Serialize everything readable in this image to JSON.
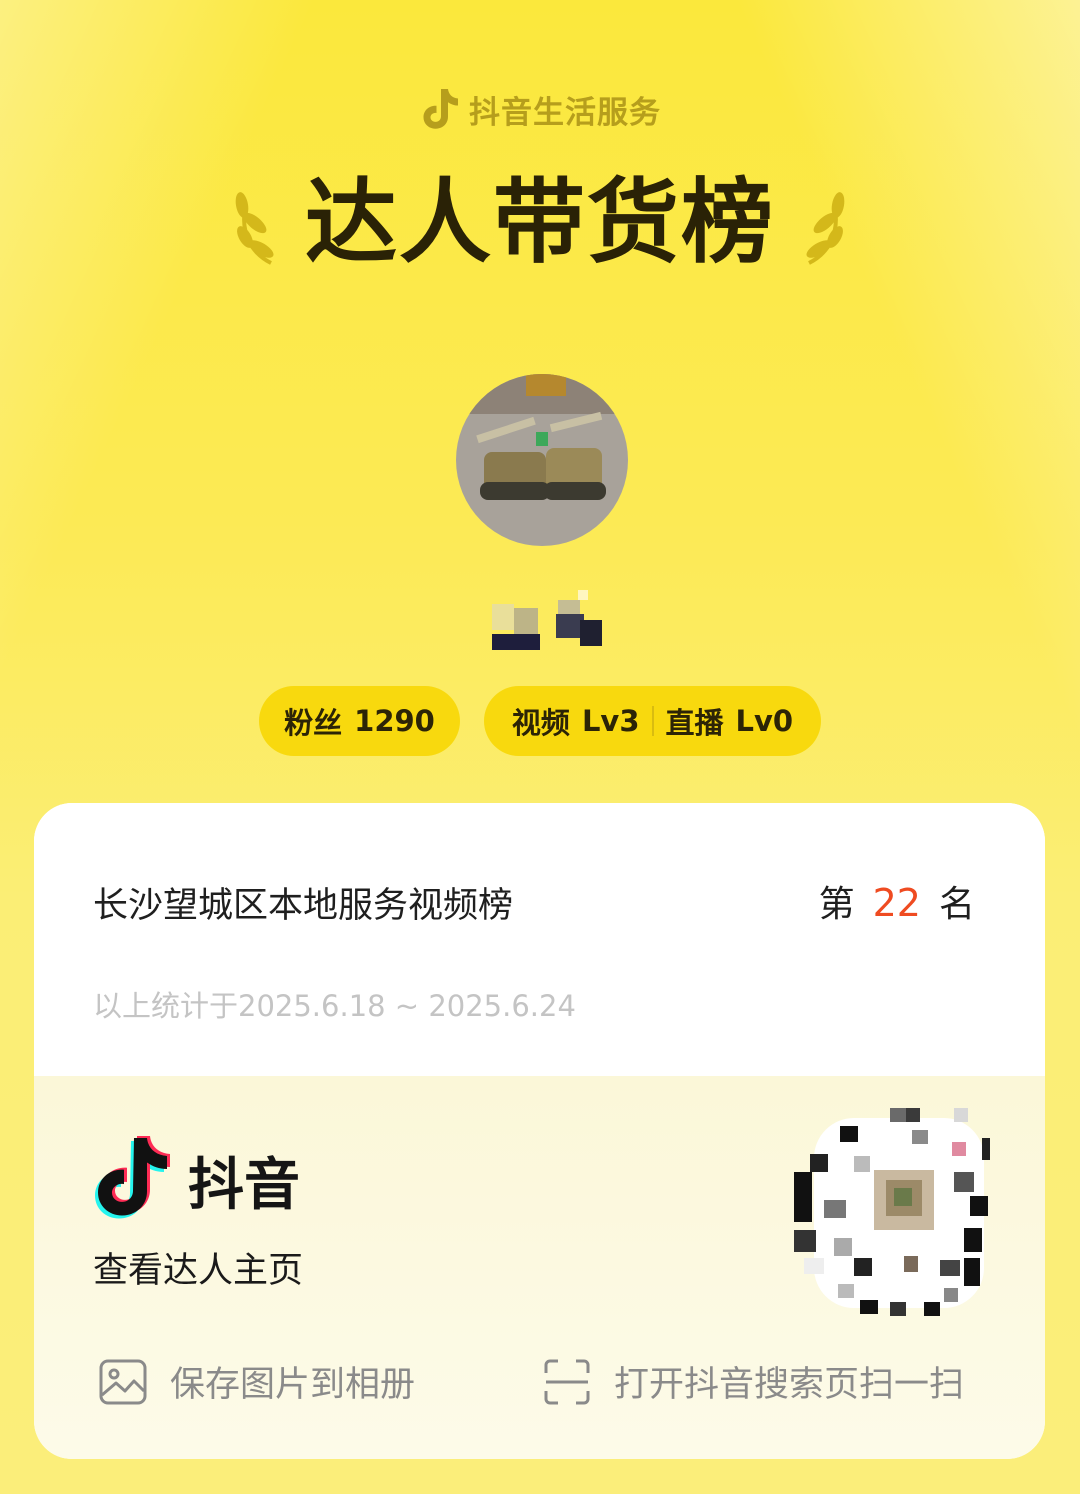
{
  "header": {
    "brand": "抖音生活服务",
    "title": "达人带货榜"
  },
  "profile": {
    "stats": {
      "fans_label": "粉丝",
      "fans_value": "1290",
      "video_label": "视频",
      "video_level": "Lv3",
      "live_label": "直播",
      "live_level": "Lv0"
    }
  },
  "rank_card": {
    "list_name": "长沙望城区本地服务视频榜",
    "rank_prefix": "第",
    "rank_number": "22",
    "rank_suffix": "名",
    "period": "以上统计于2025.6.18 ~ 2025.6.24",
    "rank_color": "#ef4b21"
  },
  "footer": {
    "app_name": "抖音",
    "view_profile": "查看达人主页",
    "save_label": "保存图片到相册",
    "scan_label": "打开抖音搜索页扫一扫"
  },
  "icons": [
    "douyin-note-icon",
    "laurel-left-icon",
    "laurel-right-icon",
    "image-icon",
    "scan-icon"
  ],
  "colors": {
    "background": "#fbe83c",
    "pill": "#f8d90e",
    "accent": "#ef4b21"
  }
}
